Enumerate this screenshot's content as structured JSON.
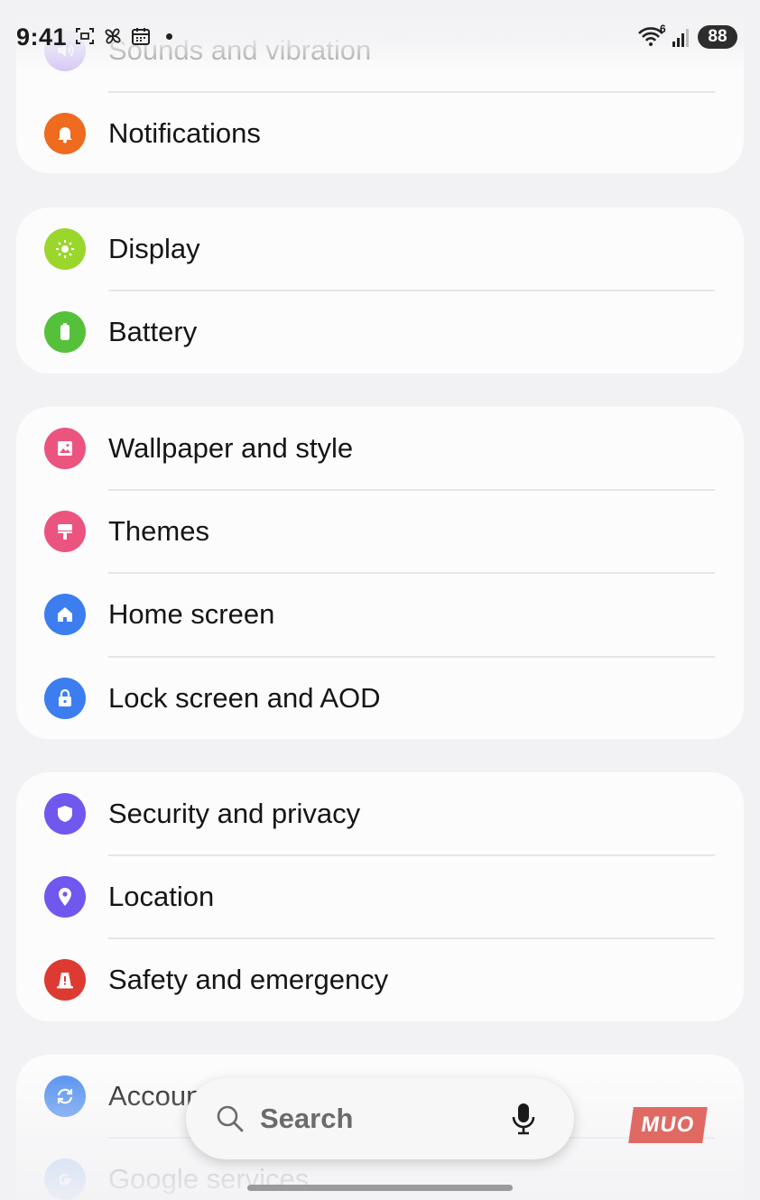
{
  "status_bar": {
    "time": "9:41",
    "wifi_superscript": "6",
    "battery_level": "88"
  },
  "settings_groups": [
    {
      "items": [
        {
          "label": "Sounds and vibration",
          "icon": "speaker-icon",
          "color": "#a78bf0"
        },
        {
          "label": "Notifications",
          "icon": "bell-icon",
          "color": "#ee6b1f"
        }
      ]
    },
    {
      "items": [
        {
          "label": "Display",
          "icon": "sun-icon",
          "color": "#9ad62c"
        },
        {
          "label": "Battery",
          "icon": "battery-icon",
          "color": "#55c13a"
        }
      ]
    },
    {
      "items": [
        {
          "label": "Wallpaper and style",
          "icon": "image-icon",
          "color": "#ec5480"
        },
        {
          "label": "Themes",
          "icon": "paintbrush-icon",
          "color": "#ec5480"
        },
        {
          "label": "Home screen",
          "icon": "home-icon",
          "color": "#3c7ef0"
        },
        {
          "label": "Lock screen and AOD",
          "icon": "lock-icon",
          "color": "#3c7ef0"
        }
      ]
    },
    {
      "items": [
        {
          "label": "Security and privacy",
          "icon": "shield-icon",
          "color": "#7058ee"
        },
        {
          "label": "Location",
          "icon": "location-pin-icon",
          "color": "#7058ee"
        },
        {
          "label": "Safety and emergency",
          "icon": "alert-icon",
          "color": "#dd3a32"
        }
      ]
    },
    {
      "items": [
        {
          "label": "Accounts and backup",
          "icon": "sync-icon",
          "color": "#4f8ef0"
        },
        {
          "label": "Google services",
          "icon": "google-icon",
          "color": "#4f8ef0"
        }
      ]
    }
  ],
  "search": {
    "placeholder": "Search"
  },
  "watermark": "MUO"
}
